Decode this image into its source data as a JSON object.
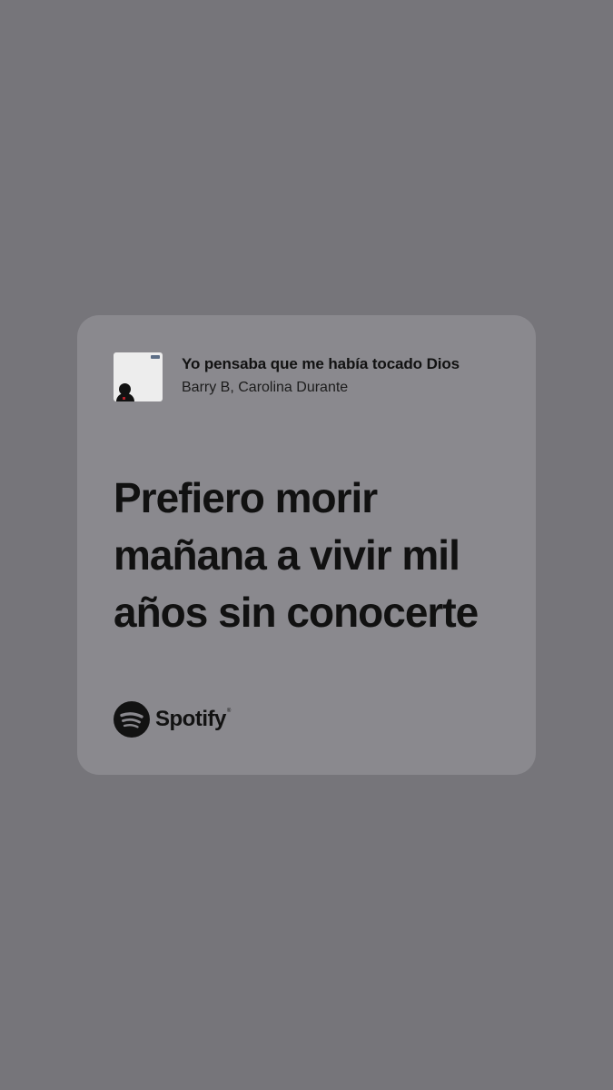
{
  "card": {
    "song": {
      "title": "Yo pensaba que me había tocado Dios",
      "artists": "Barry B, Carolina Durante"
    },
    "lyric_lines": [
      "Prefiero morir",
      "mañana a vivir mil",
      "años sin conocerte"
    ],
    "brand": {
      "name": "Spotify",
      "trademark": "®",
      "icon": "spotify-logo-icon"
    }
  },
  "colors": {
    "background": "#76757a",
    "card": "#8a898e",
    "text": "#121212"
  }
}
